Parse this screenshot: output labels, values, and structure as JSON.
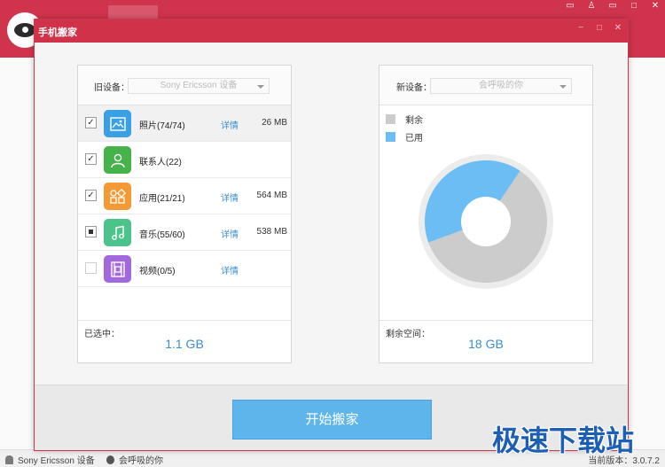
{
  "background_app": {
    "nav_icons": [
      "phone-icon",
      "apps-icon",
      "music-icon",
      "picture-icon",
      "video-icon",
      "speaker-icon",
      "search-icon",
      "tools-icon"
    ],
    "window_controls": [
      "chat-icon",
      "shirt-icon",
      "minimize-icon",
      "maximize-icon",
      "close-icon"
    ],
    "status": {
      "old_device": "Sony Ericsson 设备",
      "new_device": "会呼吸的你",
      "version": "当前版本：3.0.7.2"
    }
  },
  "dialog": {
    "title": "手机搬家",
    "old_device": {
      "label": "旧设备：",
      "selected": "Sony Ericsson 设备",
      "items": [
        {
          "name": "照片(74/74)",
          "icon": "photo-icon",
          "color": "#3aa0e6",
          "checked": "checked",
          "detail": "详情",
          "size": "26 MB",
          "selected": true
        },
        {
          "name": "联系人(22)",
          "icon": "contact-icon",
          "color": "#45b24a",
          "checked": "checked",
          "detail": "",
          "size": "",
          "selected": false
        },
        {
          "name": "应用(21/21)",
          "icon": "apps-icon",
          "color": "#f39a36",
          "checked": "checked",
          "detail": "详情",
          "size": "564 MB",
          "selected": false
        },
        {
          "name": "音乐(55/60)",
          "icon": "music-icon",
          "color": "#4cc38a",
          "checked": "partial",
          "detail": "详情",
          "size": "538 MB",
          "selected": false
        },
        {
          "name": "视频(0/5)",
          "icon": "video-icon",
          "color": "#a268de",
          "checked": "unchecked",
          "detail": "详情",
          "size": "",
          "selected": false
        }
      ],
      "footer_label": "已选中：",
      "footer_value": "1.1 GB"
    },
    "new_device": {
      "label": "新设备：",
      "selected": "会呼吸的你",
      "legend": [
        {
          "label": "剩余",
          "color": "#cccccc"
        },
        {
          "label": "已用",
          "color": "#6bbdf4"
        }
      ],
      "used_fraction": 0.4,
      "footer_label": "剩余空间：",
      "footer_value": "18 GB"
    },
    "start_button": "开始搬家"
  },
  "watermark": "极速下载站"
}
